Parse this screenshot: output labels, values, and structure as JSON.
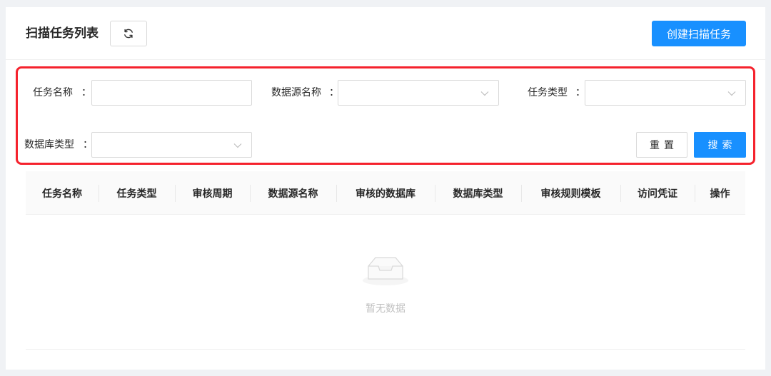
{
  "header": {
    "title": "扫描任务列表",
    "refresh_icon": "refresh-icon",
    "create_label": "创建扫描任务"
  },
  "filters": {
    "task_name_label": "任务名称",
    "datasource_label": "数据源名称",
    "task_type_label": "任务类型",
    "db_type_label": "数据库类型",
    "colon": "：",
    "task_name_value": "",
    "datasource_value": "",
    "task_type_value": "",
    "db_type_value": "",
    "reset_label": "重置",
    "search_label": "搜索",
    "highlight_color": "#f5222d"
  },
  "table": {
    "columns": [
      "任务名称",
      "任务类型",
      "审核周期",
      "数据源名称",
      "审核的数据库",
      "数据库类型",
      "审核规则模板",
      "访问凭证",
      "操作"
    ],
    "rows": [],
    "empty_text": "暂无数据",
    "empty_icon": "empty-inbox-icon"
  },
  "colors": {
    "primary": "#1890ff",
    "background": "#f0f2f5"
  }
}
